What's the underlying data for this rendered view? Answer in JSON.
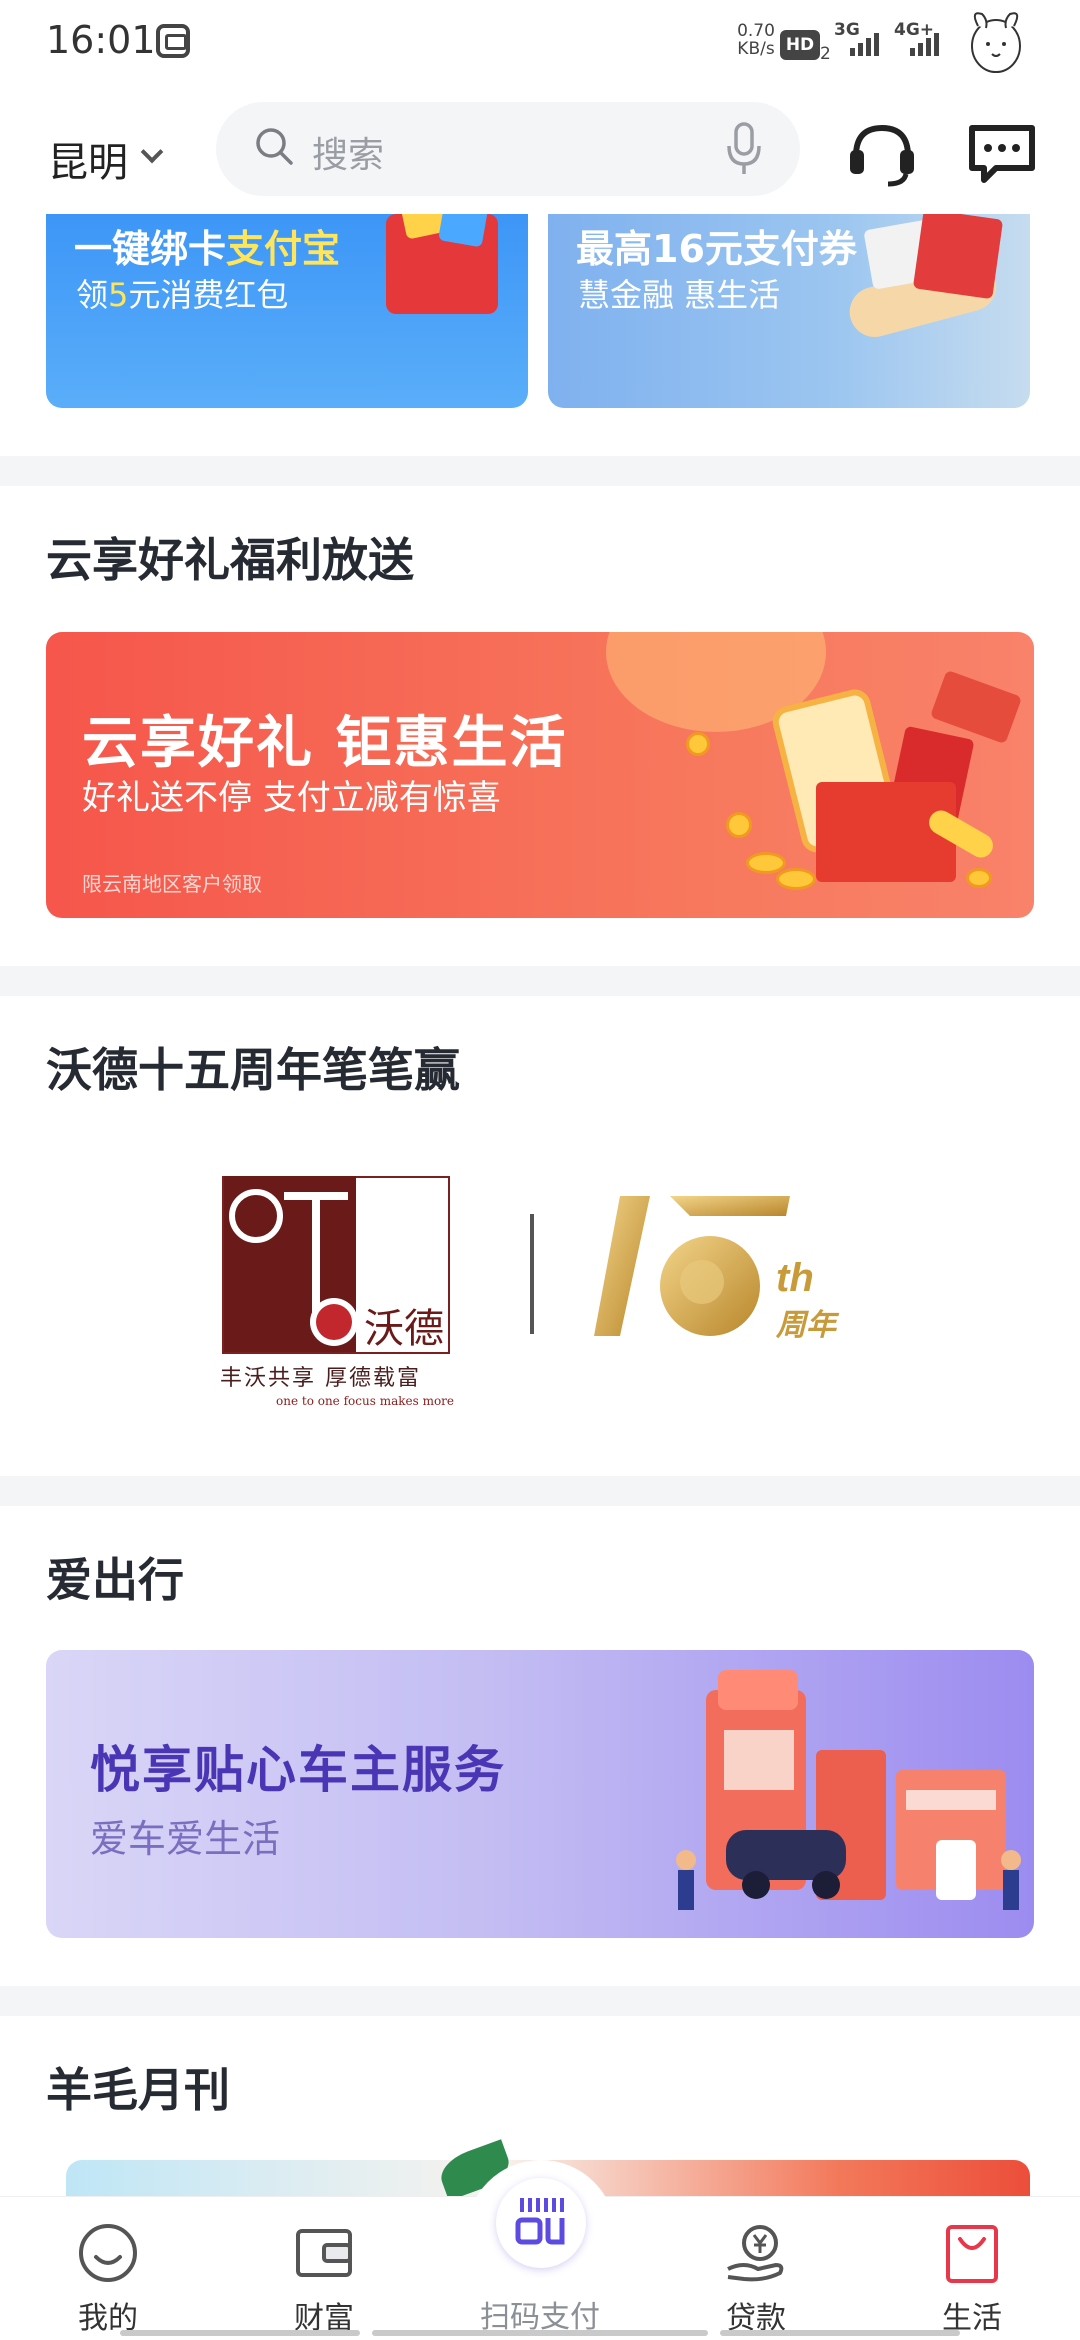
{
  "status_bar": {
    "time": "16:01",
    "net_speed": "0.70",
    "net_speed_unit": "KB/s",
    "hd_label": "HD",
    "hd_sub": "2",
    "signal_1": "3G",
    "signal_2": "4G+"
  },
  "header": {
    "city": "昆明",
    "search_placeholder": "搜索"
  },
  "top_banners": [
    {
      "title_prefix": "一键绑卡",
      "title_highlight": "支付宝",
      "sub_prefix": "领",
      "sub_highlight": "5",
      "sub_suffix": "元消费红包"
    },
    {
      "title": "最高16元支付券",
      "sub": "慧金融  惠生活"
    }
  ],
  "sections": {
    "gift": {
      "title": "云享好礼福利放送",
      "banner_title": "云享好礼  钜惠生活",
      "banner_sub": "好礼送不停  支付立减有惊喜",
      "banner_note": "限云南地区客户领取"
    },
    "wode": {
      "title": "沃德十五周年笔笔赢",
      "logo_cn": "沃德",
      "slogan": "丰沃共享  厚德载富",
      "tagline": "one to one   focus makes more",
      "anniv_suffix": "th",
      "anniv_label": "周年"
    },
    "travel": {
      "title": "爱出行",
      "banner_title": "悦享贴心车主服务",
      "banner_sub": "爱车爱生活"
    },
    "monthly": {
      "title": "羊毛月刊"
    }
  },
  "bottom_nav": [
    {
      "label": "我的",
      "icon": "smile-icon"
    },
    {
      "label": "财富",
      "icon": "wallet-icon"
    },
    {
      "label": "扫码支付",
      "icon": "scan-icon"
    },
    {
      "label": "贷款",
      "icon": "loan-icon"
    },
    {
      "label": "生活",
      "icon": "shopping-bag-icon"
    }
  ],
  "colors": {
    "accent_red": "#e8374a",
    "scan_purple": "#5b4be0",
    "banner_blue": "#3d96f7",
    "gift_red": "#f6564b",
    "travel_purple": "#4a36b5"
  }
}
